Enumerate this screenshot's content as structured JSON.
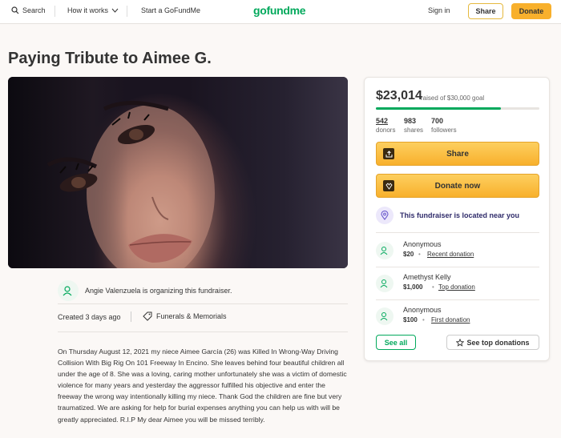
{
  "nav": {
    "search_label": "Search",
    "how_it_works_label": "How it works",
    "start_label": "Start a GoFundMe",
    "logo_text": "gofundme",
    "sign_in_label": "Sign in",
    "share_label": "Share",
    "donate_label": "Donate"
  },
  "campaign": {
    "title": "Paying Tribute to Aimee G.",
    "organizer_text": "Angie Valenzuela is organizing this fundraiser.",
    "created_text": "Created 3 days ago",
    "category_text": "Funerals & Memorials",
    "story": "On Thursday August 12, 2021 my niece Aimee García (26) was Killed In Wrong-Way Driving Collision With Big Rig On 101 Freeway In Encino. She leaves behind four beautiful children all under the age of 8. She was a loving, caring mother unfortunately she was a victim of domestic violence for many years and yesterday the aggressor fulfilled his objective and enter the freeway the wrong way intentionally killing my niece. Thank God the children are fine but very traumatized. We are asking for help for burial expenses anything you can help us with will be greatly appreciated. R.I.P My dear Aimee you will be missed terribly."
  },
  "card": {
    "raised": "$23,014",
    "goal_text": "raised of $30,000 goal",
    "progress": 0.767,
    "stats": [
      {
        "value": "542",
        "label": "donors"
      },
      {
        "value": "983",
        "label": "shares"
      },
      {
        "value": "700",
        "label": "followers"
      }
    ],
    "share_label": "Share",
    "donate_now_label": "Donate now",
    "near_text": "This fundraiser is located near you",
    "donations": [
      {
        "name": "Anonymous",
        "amount": "$20",
        "tag": "Recent donation"
      },
      {
        "name": "Amethyst Kelly",
        "amount": "$1,000",
        "tag": "Top donation"
      },
      {
        "name": "Anonymous",
        "amount": "$100",
        "tag": "First donation"
      }
    ],
    "see_all_label": "See all",
    "see_top_label": "See top donations"
  },
  "colors": {
    "brand_green": "#02a95c",
    "button_yellow": "#f8b02c",
    "near_purple": "#2f2b6a"
  }
}
